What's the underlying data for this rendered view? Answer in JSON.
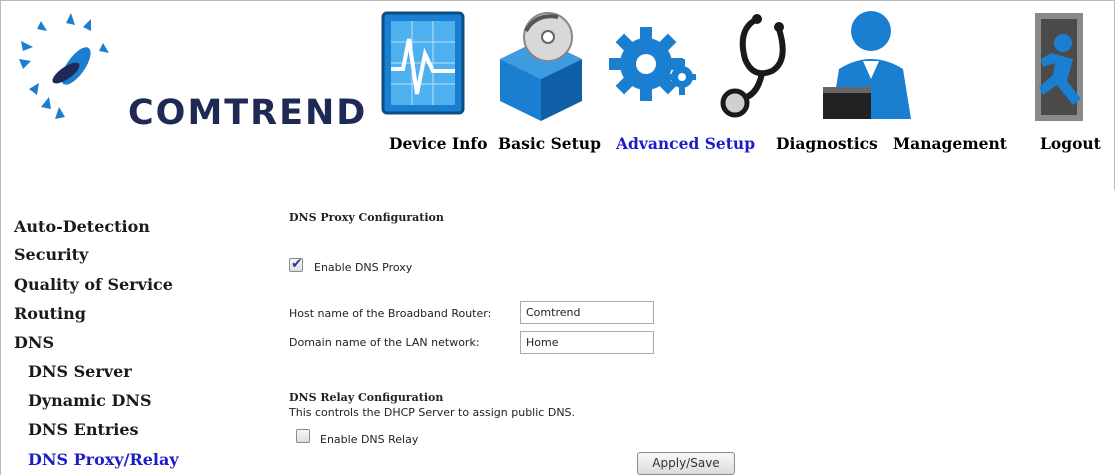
{
  "brand": {
    "logo_text": "COMTREND"
  },
  "nav": [
    {
      "label": "Device Info",
      "icon": "monitor-graph-icon",
      "active": false
    },
    {
      "label": "Basic Setup",
      "icon": "box-disc-icon",
      "active": false
    },
    {
      "label": "Advanced Setup",
      "icon": "gears-icon",
      "active": true
    },
    {
      "label": "Diagnostics",
      "icon": "stethoscope-icon",
      "active": false
    },
    {
      "label": "Management",
      "icon": "user-laptop-icon",
      "active": false
    },
    {
      "label": "Logout",
      "icon": "exit-door-icon",
      "active": false
    }
  ],
  "sidebar": [
    {
      "label": "Auto-Detection",
      "level": 0,
      "active": false
    },
    {
      "label": "Security",
      "level": 0,
      "active": false
    },
    {
      "label": "Quality of Service",
      "level": 0,
      "active": false
    },
    {
      "label": "Routing",
      "level": 0,
      "active": false
    },
    {
      "label": "DNS",
      "level": 0,
      "active": false
    },
    {
      "label": "DNS Server",
      "level": 1,
      "active": false
    },
    {
      "label": "Dynamic DNS",
      "level": 1,
      "active": false
    },
    {
      "label": "DNS Entries",
      "level": 1,
      "active": false
    },
    {
      "label": "DNS Proxy/Relay",
      "level": 1,
      "active": true
    }
  ],
  "proxy": {
    "title": "DNS Proxy Configuration",
    "enable_label": "Enable DNS Proxy",
    "enable_checked": true,
    "host_label": "Host name of the Broadband Router:",
    "host_value": "Comtrend",
    "domain_label": "Domain name of the LAN network:",
    "domain_value": "Home"
  },
  "relay": {
    "title": "DNS Relay Configuration",
    "description": "This controls the DHCP Server to assign public DNS.",
    "enable_label": "Enable DNS Relay",
    "enable_checked": false
  },
  "apply_label": "Apply/Save",
  "colors": {
    "active_link": "#1d1dc8",
    "brand_dark": "#1e2a55",
    "icon_blue": "#1b7fd1",
    "icon_dark": "#1a1a1a"
  }
}
